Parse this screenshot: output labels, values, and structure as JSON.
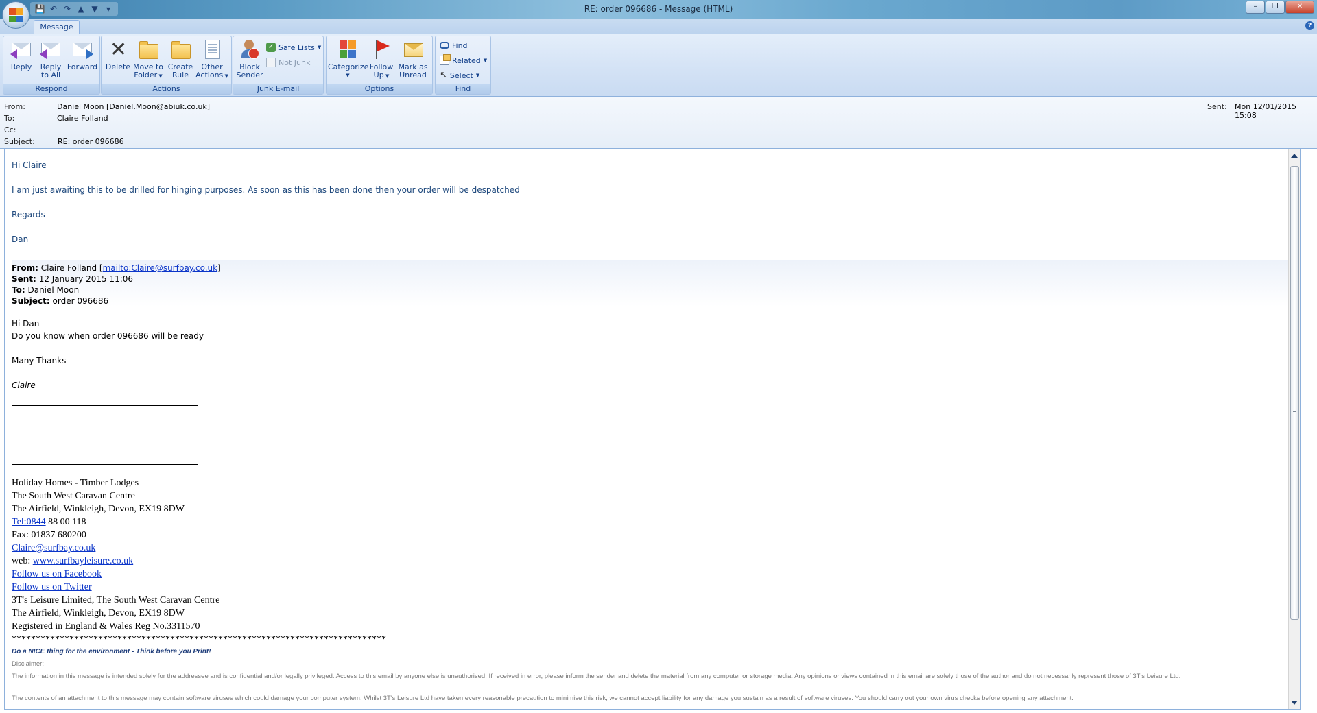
{
  "window": {
    "title": "RE: order 096686 - Message (HTML)",
    "controls": {
      "minimize": "–",
      "restore": "❐",
      "close": "✕"
    }
  },
  "qat": {
    "save": "💾",
    "undo": "↶",
    "redo": "↷",
    "up": "▲",
    "down": "▼",
    "more": "▾"
  },
  "ribbon": {
    "tab": "Message",
    "help": "?",
    "groups": {
      "respond": {
        "label": "Respond",
        "reply": "Reply",
        "reply_all": [
          "Reply",
          "to All"
        ],
        "forward": "Forward"
      },
      "actions": {
        "label": "Actions",
        "delete": "Delete",
        "move_to_folder": [
          "Move to",
          "Folder"
        ],
        "create_rule": [
          "Create",
          "Rule"
        ],
        "other_actions": [
          "Other",
          "Actions"
        ]
      },
      "junk": {
        "label": "Junk E-mail",
        "block_sender": [
          "Block",
          "Sender"
        ],
        "safe_lists": "Safe Lists",
        "not_junk": "Not Junk"
      },
      "options": {
        "label": "Options",
        "categorize": "Categorize",
        "follow_up": [
          "Follow",
          "Up"
        ],
        "mark_unread": [
          "Mark as",
          "Unread"
        ]
      },
      "find": {
        "label": "Find",
        "find": "Find",
        "related": "Related",
        "select": "Select"
      }
    }
  },
  "header": {
    "from_label": "From:",
    "from_value": "Daniel Moon [Daniel.Moon@abiuk.co.uk]",
    "to_label": "To:",
    "to_value": "Claire Folland",
    "cc_label": "Cc:",
    "cc_value": "",
    "subject_label": "Subject:",
    "subject_value": "RE: order 096686",
    "sent_label": "Sent:",
    "sent_value": "Mon 12/01/2015 15:08"
  },
  "reply": {
    "greeting": "Hi Claire",
    "line": "I am just awaiting this to be drilled for hinging purposes. As soon as this has been done then your order will be despatched",
    "regards": "Regards",
    "name": "Dan"
  },
  "quoted_header": {
    "from_label": "From:",
    "from_name": "Claire Folland [",
    "from_link": "mailto:Claire@surfbay.co.uk",
    "from_close": "]",
    "sent_label": "Sent:",
    "sent_value": "12 January 2015 11:06",
    "to_label": "To:",
    "to_value": "Daniel Moon",
    "subject_label": "Subject:",
    "subject_value": "order 096686"
  },
  "original": {
    "greeting": "Hi Dan",
    "line": "Do you know when order 096686 will be ready",
    "thanks": "Many Thanks",
    "name": "Claire"
  },
  "signature": {
    "line1": "Holiday Homes - Timber Lodges",
    "line2": "The South West Caravan Centre",
    "line3": "The Airfield, Winkleigh, Devon, EX19 8DW",
    "tel_link": "Tel:0844",
    "tel_rest": " 88 00 118",
    "fax": "Fax: 01837 680200",
    "email": "Claire@surfbay.co.uk",
    "web_label": "web: ",
    "web_link": "www.surfbayleisure.co.uk",
    "facebook": "Follow us on Facebook",
    "twitter": "Follow us on Twitter",
    "company1": "3T's Leisure Limited, The South West Caravan Centre",
    "company2": "The Airfield, Winkleigh, Devon, EX19 8DW",
    "company3": "Registered in England & Wales Reg No.3311570",
    "stars": "******************************************************************************",
    "environment": "Do a NICE thing for the environment - Think before you Print!",
    "disclaimer_label": "Disclaimer:",
    "disclaimer_1": "The information in this message is intended solely for the addressee and is confidential and/or legally privileged. Access to this email by anyone else is unauthorised. If received in error, please inform the sender and delete the material from any computer or storage media. Any opinions or views contained in this email are solely those of the author and do not necessarily represent those of  3T's Leisure Ltd.",
    "disclaimer_2": "The contents of an attachment to this message may contain software viruses which could damage your computer system.  Whilst 3T's Leisure Ltd have taken every reasonable precaution to minimise this risk, we cannot accept liability for any damage you sustain as a result of software viruses.  You should carry out your own virus checks before opening any attachment."
  }
}
